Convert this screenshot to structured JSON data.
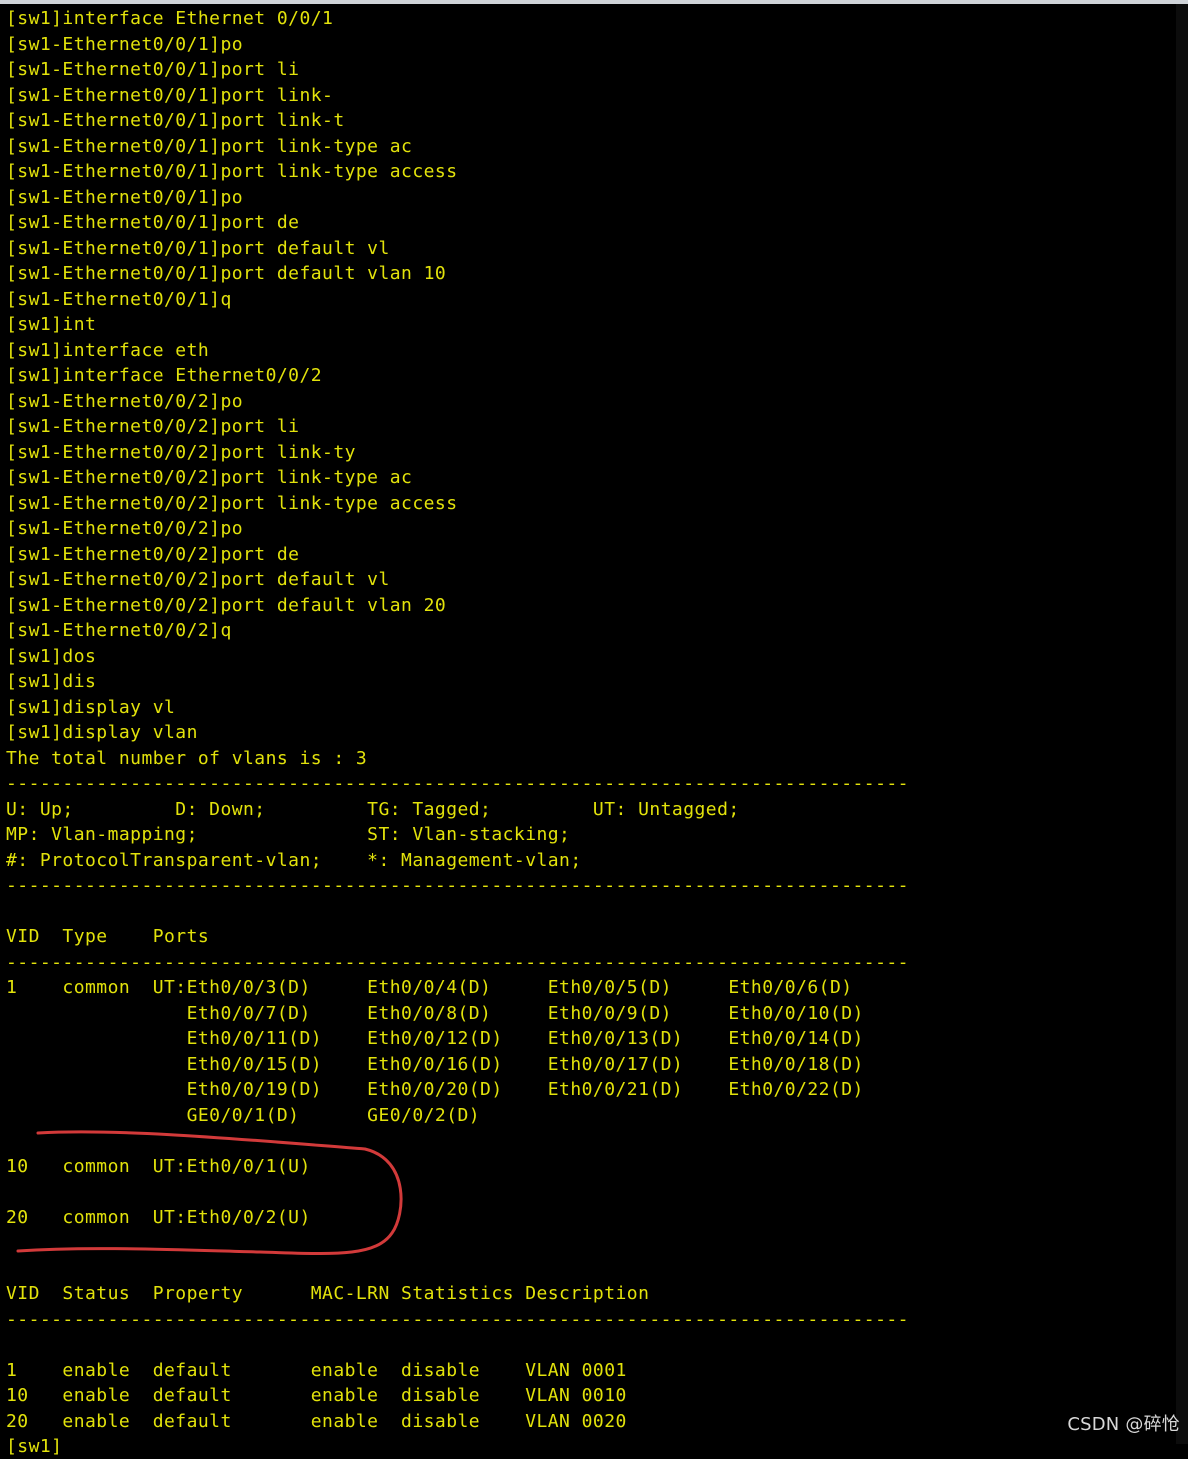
{
  "terminal": {
    "lines": [
      "[sw1]interface Ethernet 0/0/1",
      "[sw1-Ethernet0/0/1]po",
      "[sw1-Ethernet0/0/1]port li",
      "[sw1-Ethernet0/0/1]port link-",
      "[sw1-Ethernet0/0/1]port link-t",
      "[sw1-Ethernet0/0/1]port link-type ac",
      "[sw1-Ethernet0/0/1]port link-type access",
      "[sw1-Ethernet0/0/1]po",
      "[sw1-Ethernet0/0/1]port de",
      "[sw1-Ethernet0/0/1]port default vl",
      "[sw1-Ethernet0/0/1]port default vlan 10",
      "[sw1-Ethernet0/0/1]q",
      "[sw1]int",
      "[sw1]interface eth",
      "[sw1]interface Ethernet0/0/2",
      "[sw1-Ethernet0/0/2]po",
      "[sw1-Ethernet0/0/2]port li",
      "[sw1-Ethernet0/0/2]port link-ty",
      "[sw1-Ethernet0/0/2]port link-type ac",
      "[sw1-Ethernet0/0/2]port link-type access",
      "[sw1-Ethernet0/0/2]po",
      "[sw1-Ethernet0/0/2]port de",
      "[sw1-Ethernet0/0/2]port default vl",
      "[sw1-Ethernet0/0/2]port default vlan 20",
      "[sw1-Ethernet0/0/2]q",
      "[sw1]dos",
      "[sw1]dis",
      "[sw1]display vl",
      "[sw1]display vlan",
      "The total number of vlans is : 3",
      "--------------------------------------------------------------------------------",
      "U: Up;         D: Down;         TG: Tagged;         UT: Untagged;",
      "MP: Vlan-mapping;               ST: Vlan-stacking;",
      "#: ProtocolTransparent-vlan;    *: Management-vlan;",
      "--------------------------------------------------------------------------------",
      "",
      "VID  Type    Ports",
      "--------------------------------------------------------------------------------",
      "1    common  UT:Eth0/0/3(D)     Eth0/0/4(D)     Eth0/0/5(D)     Eth0/0/6(D)",
      "                Eth0/0/7(D)     Eth0/0/8(D)     Eth0/0/9(D)     Eth0/0/10(D)",
      "                Eth0/0/11(D)    Eth0/0/12(D)    Eth0/0/13(D)    Eth0/0/14(D)",
      "                Eth0/0/15(D)    Eth0/0/16(D)    Eth0/0/17(D)    Eth0/0/18(D)",
      "                Eth0/0/19(D)    Eth0/0/20(D)    Eth0/0/21(D)    Eth0/0/22(D)",
      "                GE0/0/1(D)      GE0/0/2(D)",
      "",
      "10   common  UT:Eth0/0/1(U)",
      "",
      "20   common  UT:Eth0/0/2(U)",
      "",
      "",
      "VID  Status  Property      MAC-LRN Statistics Description",
      "--------------------------------------------------------------------------------",
      "",
      "1    enable  default       enable  disable    VLAN 0001",
      "10   enable  default       enable  disable    VLAN 0010",
      "20   enable  default       enable  disable    VLAN 0020",
      "[sw1]"
    ]
  },
  "annotation": {
    "color": "#d23a3a"
  },
  "watermark": {
    "text": "CSDN @碎怆"
  },
  "colors": {
    "background": "#000000",
    "text": "#e2e20b"
  }
}
